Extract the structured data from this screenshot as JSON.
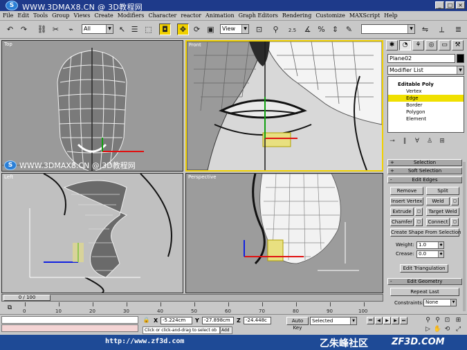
{
  "window": {
    "watermark": "WWW.3DMAX8.CN @ 3D教程网",
    "logo_glyph": "S",
    "buttons": [
      "_",
      "□",
      "×"
    ]
  },
  "menu": [
    "File",
    "Edit",
    "Tools",
    "Group",
    "Views",
    "Create",
    "Modifiers",
    "Character",
    "reactor",
    "Animation",
    "Graph Editors",
    "Rendering",
    "Customize",
    "MAXScript",
    "Help"
  ],
  "toolbar": {
    "filter_value": "All",
    "refcoord_value": "View",
    "named_selection_value": "",
    "spinner_snap_label": "2.5"
  },
  "viewports": {
    "top": "Top",
    "front": "Front",
    "left": "Left",
    "perspective": "Perspective"
  },
  "watermark2": "WWW.3DMAX8.CN @ 3D教程网",
  "panel": {
    "object_name": "Plane02",
    "modifier_list": "Modifier List",
    "stack": {
      "root": "Editable Poly",
      "items": [
        "Vertex",
        "Edge",
        "Border",
        "Polygon",
        "Element"
      ],
      "selected": "Edge"
    },
    "rollouts": {
      "selection": "Selection",
      "soft_selection": "Soft Selection",
      "edit_edges": "Edit Edges",
      "edit_geometry": "Edit Geometry"
    },
    "buttons": {
      "remove": "Remove",
      "split": "Split",
      "insert_vertex": "Insert Vertex",
      "weld": "Weld",
      "extrude": "Extrude",
      "target_weld": "Target Weld",
      "chamfer": "Chamfer",
      "connect": "Connect",
      "create_shape": "Create Shape From Selection",
      "edit_triangulation": "Edit Triangulation",
      "repeat_last": "Repeat Last"
    },
    "weight_label": "Weight:",
    "weight_value": "1.0",
    "crease_label": "Crease:",
    "crease_value": "0.0",
    "constraints_label": "Constraints:",
    "constraints_value": "None"
  },
  "timeline": {
    "frame_display": "0 / 100",
    "ticks": [
      "0",
      "10",
      "20",
      "30",
      "40",
      "50",
      "60",
      "70",
      "80",
      "90",
      "100"
    ]
  },
  "status": {
    "x_label": "X",
    "x_value": "-5.224cm",
    "y_label": "Y",
    "y_value": "-27.898cm",
    "z_label": "Z",
    "z_value": "-24.448c",
    "auto_key": "Auto Key",
    "selected_value": "Selected",
    "prompt": "Click or click-and-drag to select ob",
    "add_time": "Add"
  },
  "banner": {
    "url": "http://www.zf3d.com",
    "site": "乙朱峰社区",
    "domain": "ZF3D.COM"
  },
  "colors": {
    "selection_yellow": "#f0e000",
    "title_blue": "#1e3a8a",
    "x_axis": "#e01010",
    "y_axis": "#10a010",
    "z_axis": "#1020e0"
  }
}
